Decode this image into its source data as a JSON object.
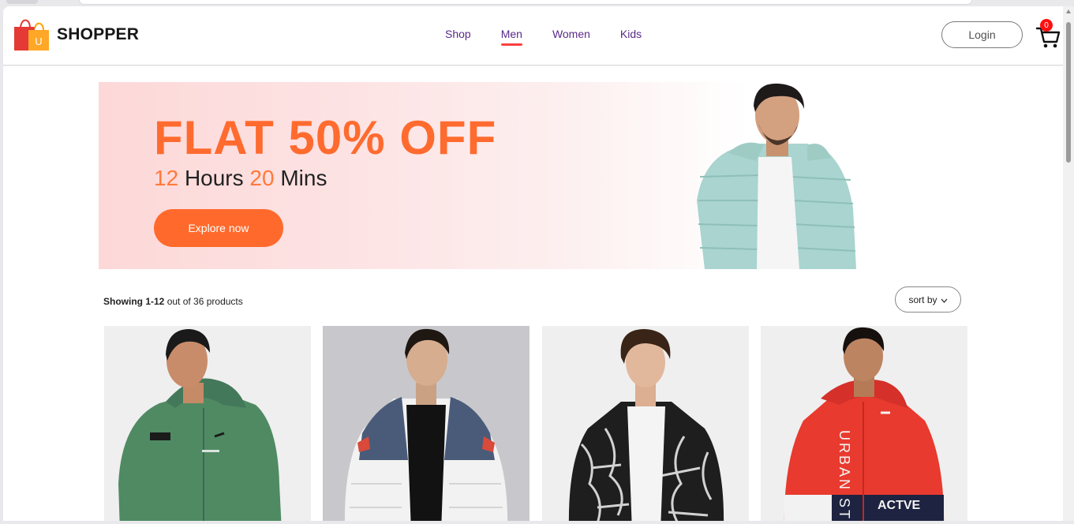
{
  "brand": {
    "name": "SHOPPER",
    "logo_letter": "U"
  },
  "nav": {
    "items": [
      {
        "label": "Shop",
        "active": false
      },
      {
        "label": "Men",
        "active": true
      },
      {
        "label": "Women",
        "active": false
      },
      {
        "label": "Kids",
        "active": false
      }
    ]
  },
  "header": {
    "login_label": "Login",
    "cart_count": "0"
  },
  "banner": {
    "headline": "FLAT 50% OFF",
    "hours_value": "12",
    "hours_label": "Hours",
    "mins_value": "20",
    "mins_label": "Mins",
    "cta_label": "Explore now"
  },
  "results": {
    "showing_bold": "Showing 1-12",
    "showing_rest": "out of 36 products"
  },
  "sort": {
    "label": "sort by"
  },
  "products": [
    {
      "image": "green-hooded-jacket"
    },
    {
      "image": "navy-white-puffer-jacket"
    },
    {
      "image": "black-marble-print-bomber"
    },
    {
      "image": "red-urban-active-jacket",
      "print_text_1": "URBAN ST",
      "print_text_2": "ACTVE"
    }
  ],
  "colors": {
    "accent": "#ff6b2f",
    "nav_text": "#582a8a",
    "active_underline": "#ff4141",
    "badge": "#ff1010"
  }
}
